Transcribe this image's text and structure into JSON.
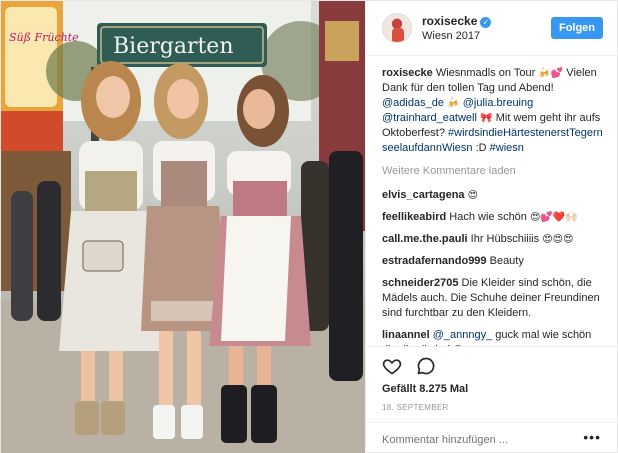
{
  "photo": {
    "sign_text": "Biergarten",
    "booth_sign_text": "Süß Früchte"
  },
  "header": {
    "username": "roxisecke",
    "verified": "✓",
    "location": "Wiesn 2017",
    "follow_label": "Folgen"
  },
  "caption": {
    "username": "roxisecke",
    "text1": " Wiesnmadls on Tour ",
    "emoji1": "🍻💕",
    "text2": " Vielen Dank für den tollen Tag und Abend! ",
    "mention1": "@adidas_de",
    "emoji2": " 🍻 ",
    "mention2": "@julia.breuing",
    "mention3": "@trainhard_eatwell",
    "emoji3": " 🎀 ",
    "text3": "Mit wem geht ihr aufs Oktoberfest?",
    "hashtag1": "#wirdsindieHärtestenerstTegernseelaufdannWiesn",
    "text4": " :D ",
    "hashtag2": "#wiesn"
  },
  "load_more": "Weitere Kommentare laden",
  "comments": [
    {
      "user": "elvis_cartagena",
      "text": "",
      "emoji": "😍"
    },
    {
      "user": "feellikeabird",
      "text": "Hach wie schön ",
      "emoji": "😍💕❤️🙌🏻"
    },
    {
      "user": "call.me.the.pauli",
      "text": "Ihr Hübschiiiis ",
      "emoji": "😍😍😍"
    },
    {
      "user": "estradafernando999",
      "text": "Beauty",
      "emoji": ""
    },
    {
      "user": "schneider2705",
      "text": "Die Kleider sind schön, die Mädels auch. Die Schuhe deiner Freundinen sind furchtbar zu den Kleidern.",
      "emoji": ""
    },
    {
      "user": "linaannel",
      "mention": "@_annngy_",
      "text": " guck mal wie schön die dirndl sind ",
      "emoji": "😍"
    }
  ],
  "actions": {
    "like_icon": "heart-icon",
    "comment_icon": "comment-bubble-icon",
    "likes": "Gefällt 8.275 Mal",
    "date": "18. SEPTEMBER",
    "comment_placeholder": "Kommentar hinzufügen ...",
    "more_label": "•••"
  }
}
